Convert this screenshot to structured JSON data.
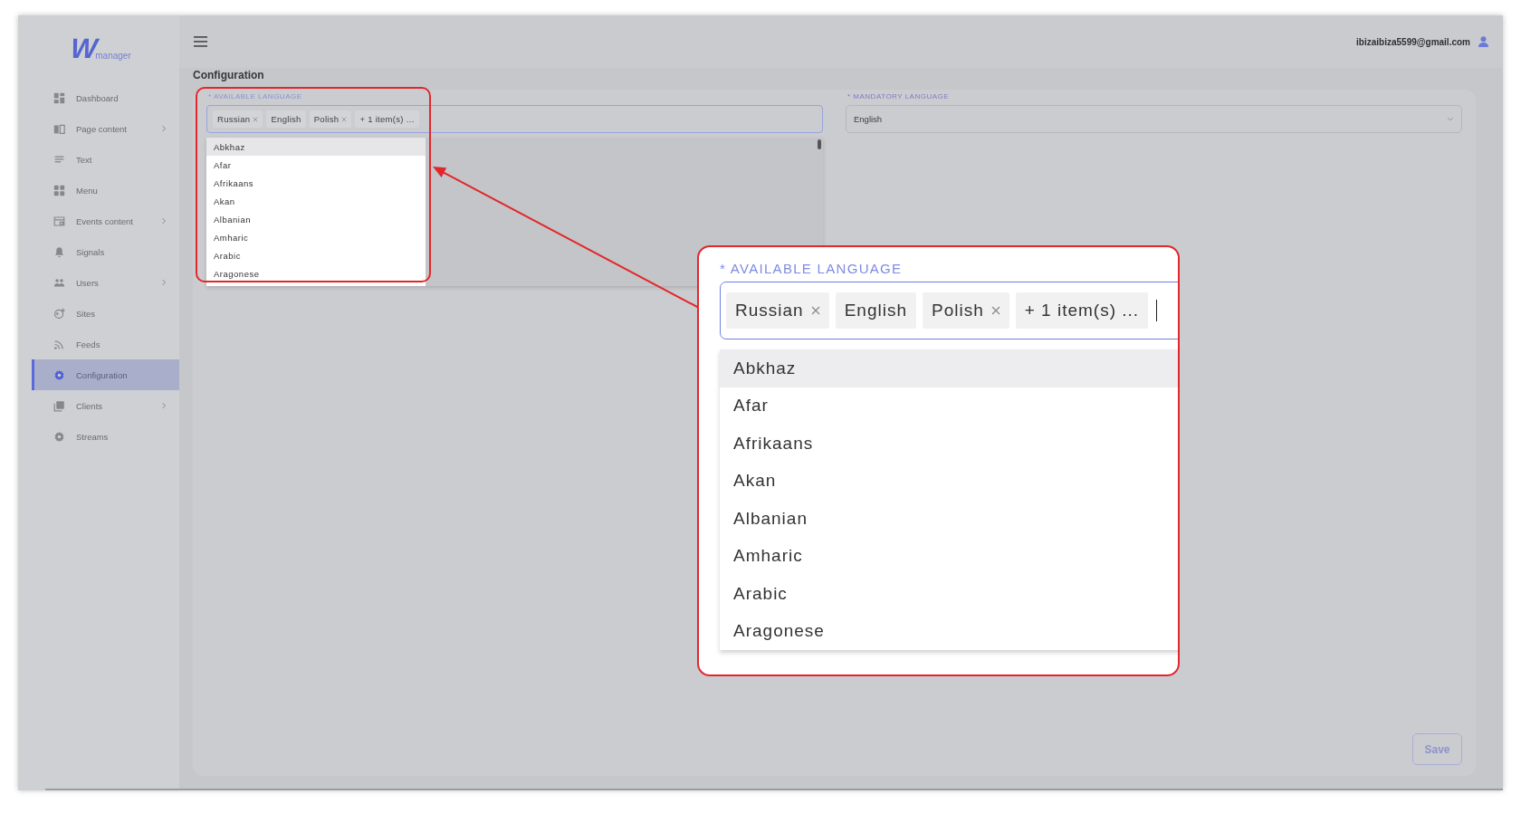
{
  "logo": {
    "mark": "W",
    "word": "manager"
  },
  "sidebar": {
    "items": [
      {
        "label": "Dashboard",
        "selected": false,
        "has_submenu": false
      },
      {
        "label": "Page content",
        "selected": false,
        "has_submenu": true
      },
      {
        "label": "Text",
        "selected": false,
        "has_submenu": false
      },
      {
        "label": "Menu",
        "selected": false,
        "has_submenu": false
      },
      {
        "label": "Events content",
        "selected": false,
        "has_submenu": true
      },
      {
        "label": "Signals",
        "selected": false,
        "has_submenu": false
      },
      {
        "label": "Users",
        "selected": false,
        "has_submenu": true
      },
      {
        "label": "Sites",
        "selected": false,
        "has_submenu": false
      },
      {
        "label": "Feeds",
        "selected": false,
        "has_submenu": false
      },
      {
        "label": "Configuration",
        "selected": true,
        "has_submenu": false
      },
      {
        "label": "Clients",
        "selected": false,
        "has_submenu": true
      },
      {
        "label": "Streams",
        "selected": false,
        "has_submenu": false
      }
    ]
  },
  "header": {
    "user_email": "ibizaibiza5599@gmail.com"
  },
  "page_title": "Configuration",
  "available_language": {
    "label": "* AVAILABLE LANGUAGE",
    "focused": true,
    "tags": [
      {
        "label": "Russian",
        "removable": true
      },
      {
        "label": "English",
        "removable": false
      },
      {
        "label": "Polish",
        "removable": true
      },
      {
        "label": "+ 1 item(s) ...",
        "removable": false
      }
    ],
    "options": [
      {
        "label": "Abkhaz",
        "selected": true
      },
      {
        "label": "Afar",
        "selected": false
      },
      {
        "label": "Afrikaans",
        "selected": false
      },
      {
        "label": "Akan",
        "selected": false
      },
      {
        "label": "Albanian",
        "selected": false
      },
      {
        "label": "Amharic",
        "selected": false
      },
      {
        "label": "Arabic",
        "selected": false
      },
      {
        "label": "Aragonese",
        "selected": false
      }
    ]
  },
  "mandatory_language": {
    "label": "* MANDATORY LANGUAGE",
    "value": "English"
  },
  "save_button": "Save",
  "callout": {
    "available_language": {
      "label": "* AVAILABLE LANGUAGE",
      "focused": true,
      "tags": [
        {
          "label": "Russian",
          "removable": true
        },
        {
          "label": "English",
          "removable": false
        },
        {
          "label": "Polish",
          "removable": true
        },
        {
          "label": "+ 1 item(s) ...",
          "removable": false
        }
      ],
      "options": [
        {
          "label": "Abkhaz",
          "selected": true
        },
        {
          "label": "Afar",
          "selected": false
        },
        {
          "label": "Afrikaans",
          "selected": false
        },
        {
          "label": "Akan",
          "selected": false
        },
        {
          "label": "Albanian",
          "selected": false
        },
        {
          "label": "Amharic",
          "selected": false
        },
        {
          "label": "Arabic",
          "selected": false
        },
        {
          "label": "Aragonese",
          "selected": false
        }
      ]
    }
  }
}
